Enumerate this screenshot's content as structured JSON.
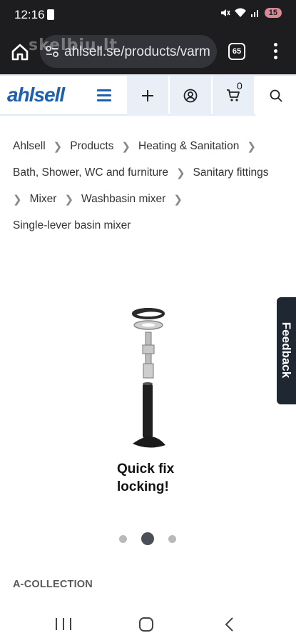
{
  "status_bar": {
    "time": "12:16",
    "battery": "15"
  },
  "browser": {
    "url": "ahlsell.se/products/varm",
    "watermark": "skelbiu.lt",
    "tab_count": "65"
  },
  "site_header": {
    "logo": "ahlsell",
    "cart_count": "0",
    "brand_color": "#1b61ad"
  },
  "breadcrumb": {
    "rows": [
      [
        "Ahlsell",
        "Products",
        "Heating & Sanitation"
      ],
      [
        "Bath, Shower, WC and furniture",
        "Sanitary fittings"
      ],
      [
        "Mixer",
        "Washbasin mixer"
      ]
    ],
    "current": "Single-lever basin mixer"
  },
  "product": {
    "image_caption_line1": "Quick fix",
    "image_caption_line2": "locking!",
    "carousel": {
      "slides": 3,
      "active_index": 1
    },
    "collection": "A-COLLECTION"
  },
  "feedback": {
    "label": "Feedback"
  }
}
